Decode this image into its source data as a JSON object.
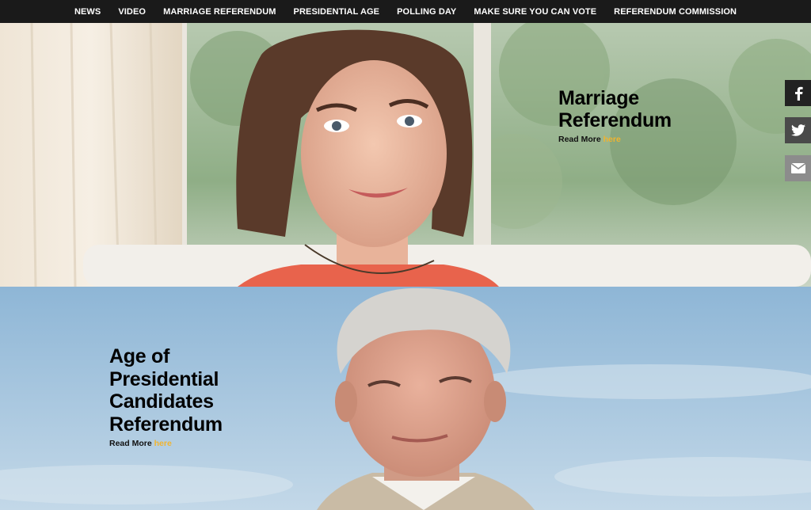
{
  "nav": {
    "items": [
      "NEWS",
      "VIDEO",
      "MARRIAGE REFERENDUM",
      "PRESIDENTIAL AGE",
      "POLLING DAY",
      "MAKE SURE YOU CAN VOTE",
      "REFERENDUM COMMISSION"
    ]
  },
  "hero1": {
    "title_line1": "Marriage",
    "title_line2": "Referendum",
    "read_more": "Read More ",
    "here": "here"
  },
  "hero2": {
    "title_line1": "Age of",
    "title_line2": "Presidential",
    "title_line3": "Candidates",
    "title_line4": "Referendum",
    "read_more": "Read More ",
    "here": "here"
  },
  "share": {
    "icons": [
      "facebook-icon",
      "twitter-icon",
      "email-icon"
    ]
  },
  "colors": {
    "nav_bg": "#1a1a1a",
    "link_accent": "#f1b42f"
  }
}
